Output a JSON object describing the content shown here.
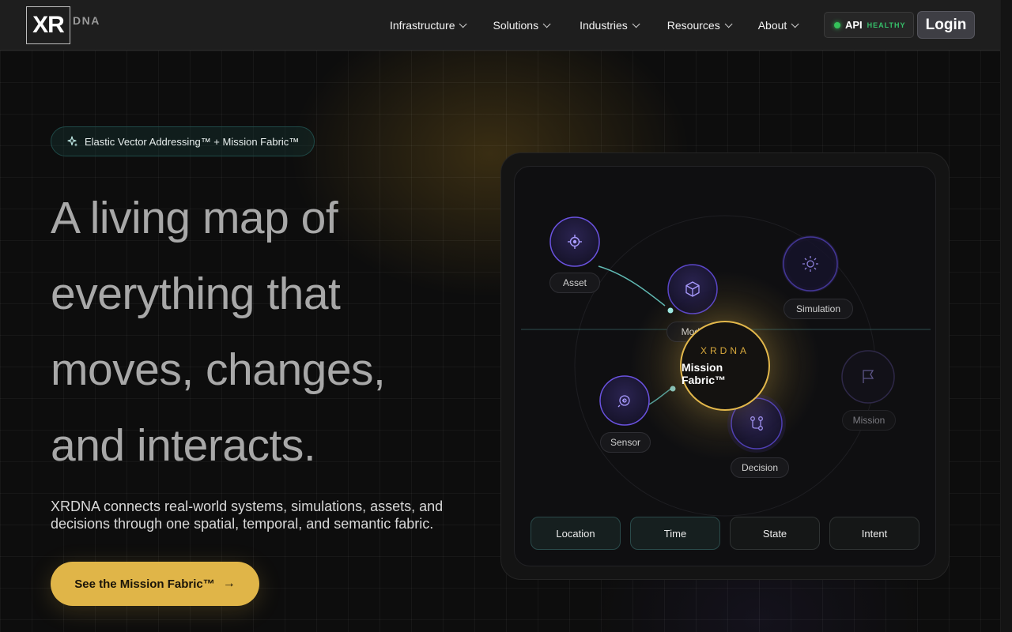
{
  "header": {
    "logo_mark": "XR",
    "logo_suffix": "DNA",
    "nav": [
      "Infrastructure",
      "Solutions",
      "Industries",
      "Resources",
      "About"
    ],
    "api_label": "API",
    "api_status": "HEALTHY",
    "login_label": "Login"
  },
  "hero": {
    "pill_text": "Elastic Vector Addressing™ + Mission Fabric™",
    "title_lines": [
      "A living map of",
      "everything that",
      "moves, changes,",
      "and interacts."
    ],
    "subtitle": "XRDNA connects real-world systems, simulations, assets, and decisions through one spatial, temporal, and semantic fabric.",
    "cta_label": "See the Mission Fabric™",
    "cta_arrow": "→"
  },
  "fabric": {
    "center_brand": "XRDNA",
    "center_title": "Mission Fabric™",
    "nodes": [
      {
        "label": "Asset",
        "icon": "crosshair-icon"
      },
      {
        "label": "Model",
        "icon": "cube-icon"
      },
      {
        "label": "Simulation",
        "icon": "sun-icon"
      },
      {
        "label": "Sensor",
        "icon": "sensor-icon"
      },
      {
        "label": "Decision",
        "icon": "branch-icon"
      },
      {
        "label": "Mission",
        "icon": "flag-icon"
      }
    ],
    "dimensions": [
      "Location",
      "Time",
      "State",
      "Intent"
    ]
  },
  "colors": {
    "accent": "#e0b548",
    "teal": "#6fd6cf",
    "node_purple": "#7a5cf0",
    "api_green": "#35c25a"
  }
}
